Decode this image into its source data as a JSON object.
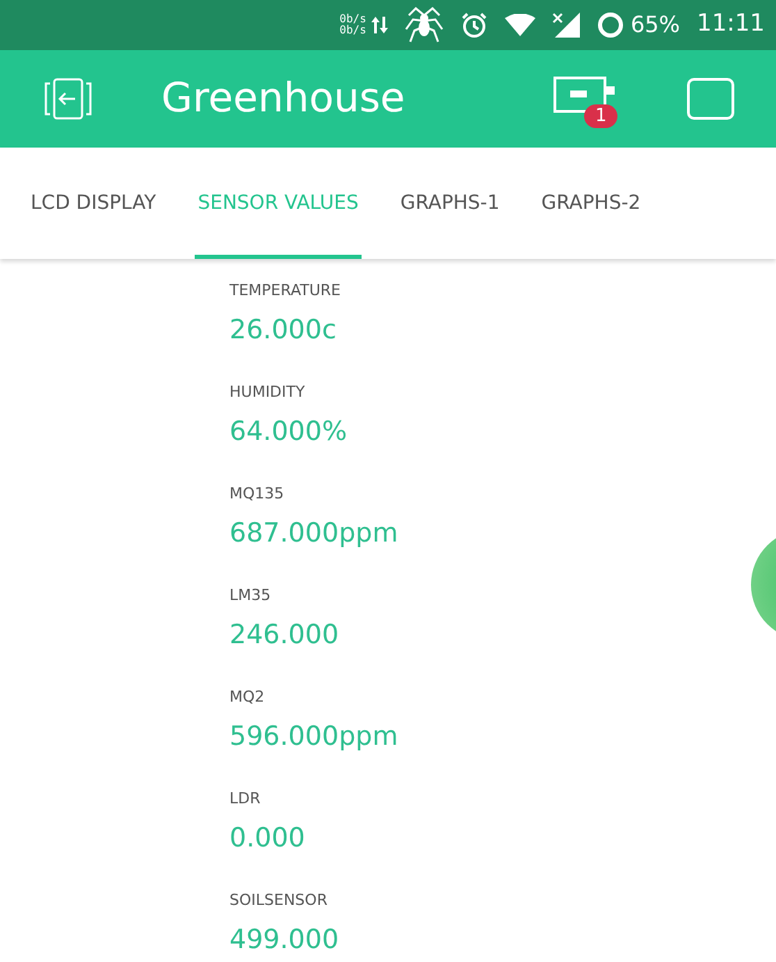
{
  "status_bar": {
    "net_speed_up": "0b/s",
    "net_speed_down": "0b/s",
    "battery": "65%",
    "time": "11:11"
  },
  "app_bar": {
    "title": "Greenhouse",
    "device_badge": "1"
  },
  "tabs": [
    {
      "label": "LCD DISPLAY",
      "selected": false
    },
    {
      "label": "SENSOR VALUES",
      "selected": true
    },
    {
      "label": "GRAPHS-1",
      "selected": false
    },
    {
      "label": "GRAPHS-2",
      "selected": false
    }
  ],
  "sensors": [
    {
      "label": "TEMPERATURE",
      "value": "26.000c"
    },
    {
      "label": "HUMIDITY",
      "value": "64.000%"
    },
    {
      "label": "MQ135",
      "value": "687.000ppm"
    },
    {
      "label": "LM35",
      "value": "246.000"
    },
    {
      "label": "MQ2",
      "value": "596.000ppm"
    },
    {
      "label": "LDR",
      "value": "0.000"
    },
    {
      "label": "SOILSENSOR",
      "value": "499.000"
    }
  ]
}
